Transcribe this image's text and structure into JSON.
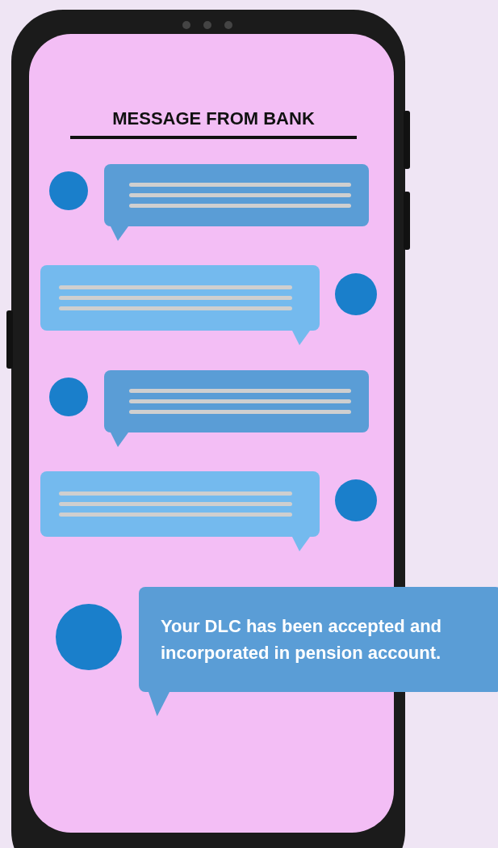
{
  "title": "MESSAGE FROM BANK",
  "messages": [
    {
      "outgoing": false,
      "kind": "lines"
    },
    {
      "outgoing": true,
      "kind": "lines"
    },
    {
      "outgoing": false,
      "kind": "lines"
    },
    {
      "outgoing": true,
      "kind": "lines"
    },
    {
      "outgoing": false,
      "kind": "text",
      "text": "Your DLC has been accepted and incorporated in pension account."
    }
  ]
}
